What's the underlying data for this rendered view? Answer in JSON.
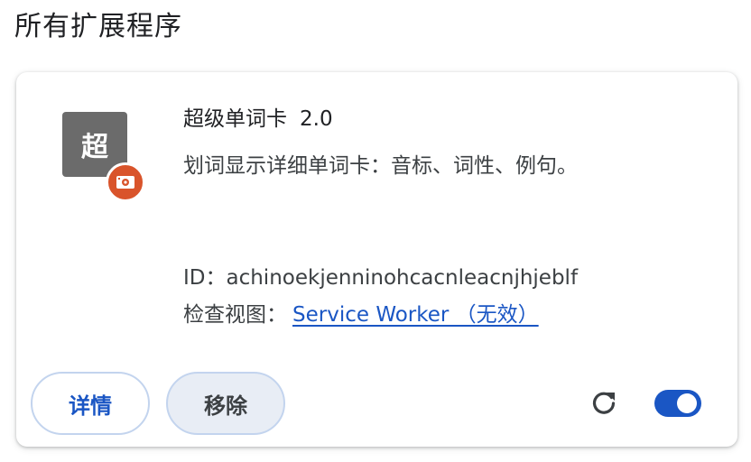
{
  "page": {
    "section_title": "所有扩展程序"
  },
  "extension": {
    "icon_text": "超",
    "icon_bg": "#6b6b6b",
    "badge_icon": "puzzle-badge-icon",
    "badge_color": "#d9542b",
    "name": "超级单词卡",
    "version": "2.0",
    "description": "划词显示详细单词卡：音标、词性、例句。",
    "id_line": "ID：achinoekjenninohcacnleacnjhjeblf",
    "inspect_label": "检查视图：",
    "inspect_link": "Service Worker （无效）"
  },
  "actions": {
    "details_label": "详情",
    "remove_label": "移除",
    "reload_icon": "reload-icon",
    "enabled": true,
    "accent_color": "#1a56c4"
  }
}
